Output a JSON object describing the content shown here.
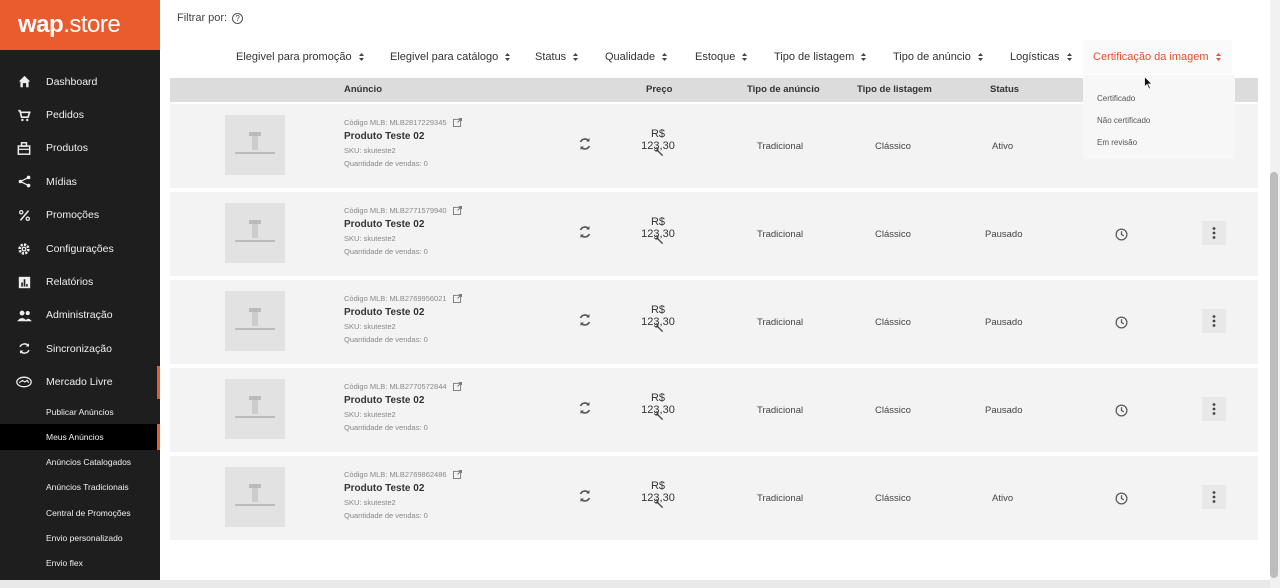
{
  "logo": {
    "brand": "wap",
    "suffix": ".store"
  },
  "sidebar": {
    "items": [
      {
        "label": "Dashboard",
        "icon": "home-icon"
      },
      {
        "label": "Pedidos",
        "icon": "cart-icon"
      },
      {
        "label": "Produtos",
        "icon": "box-icon"
      },
      {
        "label": "Mídias",
        "icon": "share-icon"
      },
      {
        "label": "Promoções",
        "icon": "percent-icon"
      },
      {
        "label": "Configurações",
        "icon": "gear-icon"
      },
      {
        "label": "Relatórios",
        "icon": "report-icon"
      },
      {
        "label": "Administração",
        "icon": "users-icon"
      },
      {
        "label": "Sincronização",
        "icon": "sync-icon"
      },
      {
        "label": "Mercado Livre",
        "icon": "handshake-icon"
      }
    ],
    "subitems": [
      {
        "label": "Publicar Anúncios"
      },
      {
        "label": "Meus Anúncios"
      },
      {
        "label": "Anúncios Catalogados"
      },
      {
        "label": "Anúncios Tradicionais"
      },
      {
        "label": "Central de Promoções"
      },
      {
        "label": "Envio personalizado"
      },
      {
        "label": "Envio flex"
      }
    ]
  },
  "filter_label": "Filtrar por:",
  "filters": [
    {
      "label": "Elegivel para promoção"
    },
    {
      "label": "Elegivel para catálogo"
    },
    {
      "label": "Status"
    },
    {
      "label": "Qualidade"
    },
    {
      "label": "Estoque"
    },
    {
      "label": "Tipo de listagem"
    },
    {
      "label": "Tipo de anúncio"
    },
    {
      "label": "Logísticas"
    },
    {
      "label": "Certificação da imagem"
    }
  ],
  "dropdown": {
    "options": [
      "Certificado",
      "Não certificado",
      "Em revisão"
    ]
  },
  "table": {
    "headers": {
      "anuncio": "Anúncio",
      "preco": "Preço",
      "tipo_anuncio": "Tipo de anúncio",
      "tipo_listagem": "Tipo de listagem",
      "status": "Status"
    },
    "rows": [
      {
        "mlb": "Código MLB: MLB2817229345",
        "name": "Produto Teste 02",
        "sku": "SKU: skuteste2",
        "qty": "Quantidade de vendas: 0",
        "price": "R$ 123,30",
        "tipo_anuncio": "Tradicional",
        "tipo_listagem": "Clássico",
        "status": "Ativo"
      },
      {
        "mlb": "Código MLB: MLB2771579940",
        "name": "Produto Teste 02",
        "sku": "SKU: skuteste2",
        "qty": "Quantidade de vendas: 0",
        "price": "R$ 123,30",
        "tipo_anuncio": "Tradicional",
        "tipo_listagem": "Clássico",
        "status": "Pausado"
      },
      {
        "mlb": "Código MLB: MLB2769956021",
        "name": "Produto Teste 02",
        "sku": "SKU: skuteste2",
        "qty": "Quantidade de vendas: 0",
        "price": "R$ 123,30",
        "tipo_anuncio": "Tradicional",
        "tipo_listagem": "Clássico",
        "status": "Pausado"
      },
      {
        "mlb": "Código MLB: MLB2770572844",
        "name": "Produto Teste 02",
        "sku": "SKU: skuteste2",
        "qty": "Quantidade de vendas: 0",
        "price": "R$ 123,30",
        "tipo_anuncio": "Tradicional",
        "tipo_listagem": "Clássico",
        "status": "Pausado"
      },
      {
        "mlb": "Código MLB: MLB2769862486",
        "name": "Produto Teste 02",
        "sku": "SKU: skuteste2",
        "qty": "Quantidade de vendas: 0",
        "price": "R$ 123,30",
        "tipo_anuncio": "Tradicional",
        "tipo_listagem": "Clássico",
        "status": "Ativo"
      }
    ]
  },
  "colors": {
    "accent": "#ea5b2e",
    "sidebar_bg": "#1e1e1e"
  }
}
